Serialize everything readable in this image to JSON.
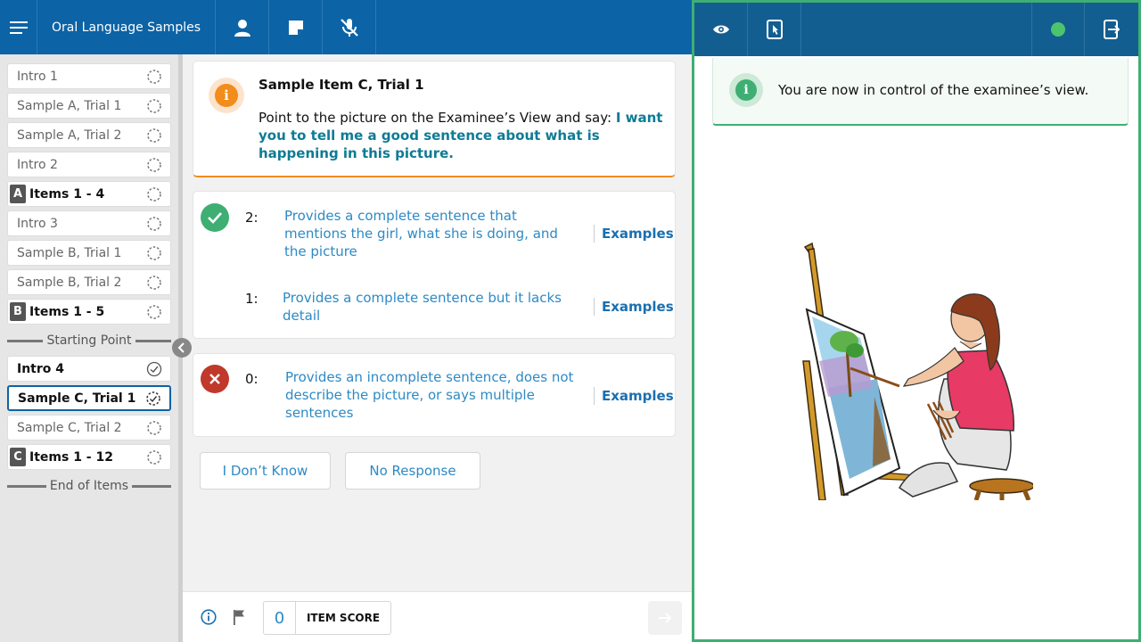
{
  "header": {
    "title": "Oral Language Samples",
    "icons": [
      "menu-icon",
      "person-icon",
      "note-icon",
      "mic-off-icon"
    ]
  },
  "sidebar": {
    "items": [
      {
        "label": "Intro 1",
        "status": "pending"
      },
      {
        "label": "Sample A, Trial 1",
        "status": "pending"
      },
      {
        "label": "Sample A, Trial 2",
        "status": "pending"
      },
      {
        "label": "Intro 2",
        "status": "pending"
      },
      {
        "badge": "A",
        "label": "Items 1 - 4",
        "status": "pending"
      },
      {
        "label": "Intro 3",
        "status": "pending"
      },
      {
        "label": "Sample B, Trial 1",
        "status": "pending"
      },
      {
        "label": "Sample B, Trial 2",
        "status": "pending"
      },
      {
        "badge": "B",
        "label": "Items 1 - 5",
        "status": "pending"
      },
      {
        "label": "Intro 4",
        "status": "complete"
      },
      {
        "label": "Sample C, Trial 1",
        "status": "in-progress"
      },
      {
        "label": "Sample C, Trial 2",
        "status": "pending"
      },
      {
        "badge": "C",
        "label": "Items 1 - 12",
        "status": "pending"
      }
    ],
    "starting_point": "Starting Point",
    "end_of_items": "End of Items"
  },
  "prompt": {
    "title": "Sample Item C, Trial 1",
    "instruction": "Point to the picture on the Examinee’s View and say: ",
    "say_text": "I want you to tell me a good sentence about what is happening in this picture."
  },
  "scores": [
    {
      "value": "2:",
      "desc": "Provides a complete sentence that mentions the girl, what she is doing, and the picture",
      "examples": "Examples"
    },
    {
      "value": "1:",
      "desc": "Provides a complete sentence but it lacks detail",
      "examples": "Examples"
    },
    {
      "value": "0:",
      "desc": "Provides an incomplete sentence, does not describe the picture, or says multiple sentences",
      "examples": "Examples"
    }
  ],
  "buttons": {
    "dont_know": "I Don’t Know",
    "no_response": "No Response"
  },
  "footer": {
    "score_value": "0",
    "score_label": "ITEM SCORE"
  },
  "examinee": {
    "notice": "You are now in control of the examinee’s view.",
    "status_color": "#4cc46e",
    "picture": "girl-painting-at-easel"
  },
  "colors": {
    "primary": "#0c63a5",
    "accent_orange": "#f28c1b",
    "success": "#3fae73",
    "error": "#c0392b",
    "link": "#2d8ac5"
  }
}
